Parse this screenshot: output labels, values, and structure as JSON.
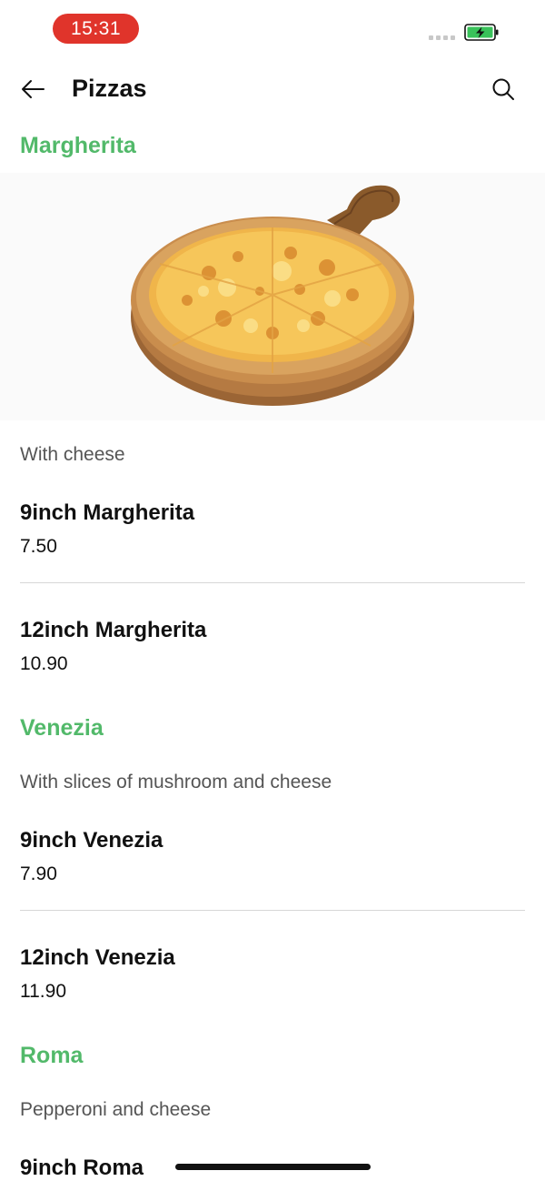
{
  "status_bar": {
    "time": "15:31",
    "accent_color": "#e0342b",
    "battery_color": "#39c25a",
    "battery_state": "charging"
  },
  "header": {
    "title": "Pizzas",
    "back_icon": "arrow-left-icon",
    "search_icon": "search-icon"
  },
  "theme": {
    "category_color": "#52b96a",
    "divider_color": "#d7d7d7"
  },
  "categories": [
    {
      "title": "Margherita",
      "has_image": true,
      "image_icon": "pizza-image",
      "description": "With cheese",
      "items": [
        {
          "name": "9inch Margherita",
          "price": "7.50"
        },
        {
          "name": "12inch Margherita",
          "price": "10.90"
        }
      ]
    },
    {
      "title": "Venezia",
      "description": "With slices of mushroom and cheese",
      "items": [
        {
          "name": "9inch Venezia",
          "price": "7.90"
        },
        {
          "name": "12inch Venezia",
          "price": "11.90"
        }
      ]
    },
    {
      "title": "Roma",
      "description": "Pepperoni and cheese",
      "items": [
        {
          "name": "9inch Roma"
        }
      ]
    }
  ]
}
